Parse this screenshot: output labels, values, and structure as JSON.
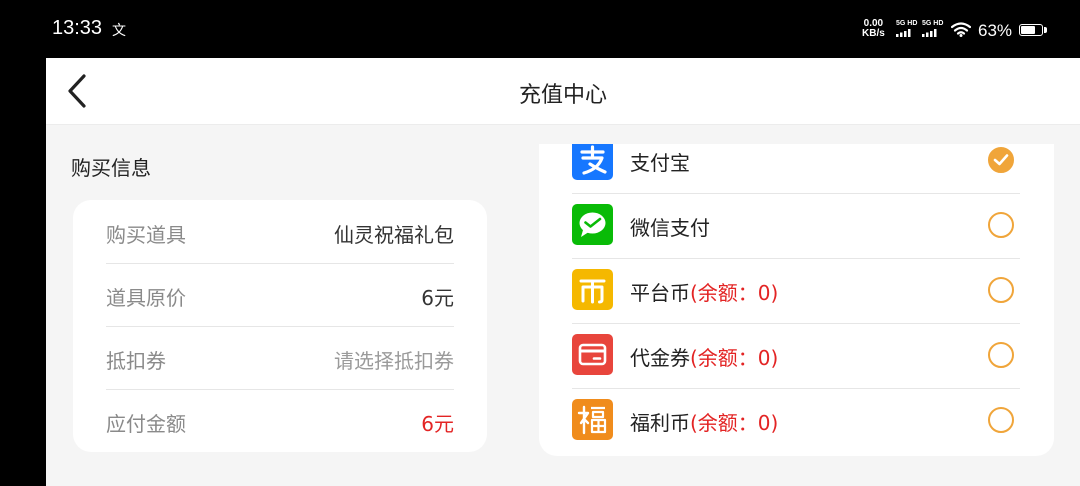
{
  "status_bar": {
    "time": "13:33",
    "notification_icon": "文",
    "net_speed_value": "0.00",
    "net_speed_unit": "KB/s",
    "signal1_label": "5G HD",
    "signal2_label": "5G HD",
    "battery": "63%"
  },
  "header": {
    "title": "充值中心"
  },
  "purchase_info": {
    "section_title": "购买信息",
    "rows": [
      {
        "label": "购买道具",
        "value": "仙灵祝福礼包"
      },
      {
        "label": "道具原价",
        "value": "6元"
      },
      {
        "label": "抵扣券",
        "value": "请选择抵扣券"
      },
      {
        "label": "应付金额",
        "value": "6元"
      }
    ]
  },
  "payment_methods": [
    {
      "name": "支付宝",
      "balance": "",
      "icon": "alipay-icon",
      "selected": true
    },
    {
      "name": "微信支付",
      "balance": "",
      "icon": "wechat-pay-icon",
      "selected": false
    },
    {
      "name": "平台币",
      "balance": "(余额：0)",
      "icon": "platform-coin-icon",
      "selected": false
    },
    {
      "name": "代金券",
      "balance": "(余额：0)",
      "icon": "voucher-icon",
      "selected": false
    },
    {
      "name": "福利币",
      "balance": "(余额：0)",
      "icon": "welfare-coin-icon",
      "selected": false
    }
  ],
  "colors": {
    "accent_orange": "#f0a53a",
    "price_red": "#e32424",
    "alipay_blue": "#1677ff",
    "wechat_green": "#09bb07",
    "platform_yellow": "#f5b800",
    "voucher_red": "#e8453c",
    "welfare_orange": "#f08c1c"
  }
}
